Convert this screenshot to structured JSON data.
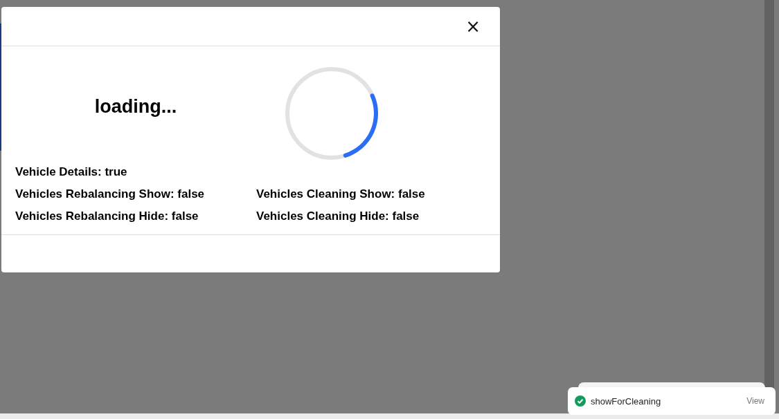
{
  "modal": {
    "close_label": "×",
    "heading": "loading...",
    "status_lines": [
      {
        "left": "Vehicle Details: true"
      },
      {
        "left": "Vehicles Rebalancing Show: false",
        "right": "Vehicles Cleaning Show: false"
      },
      {
        "left": "Vehicles Rebalancing Hide: false",
        "right": "Vehicles Cleaning Hide: false"
      }
    ]
  },
  "toast": {
    "message": "showForCleaning",
    "action": "View"
  }
}
